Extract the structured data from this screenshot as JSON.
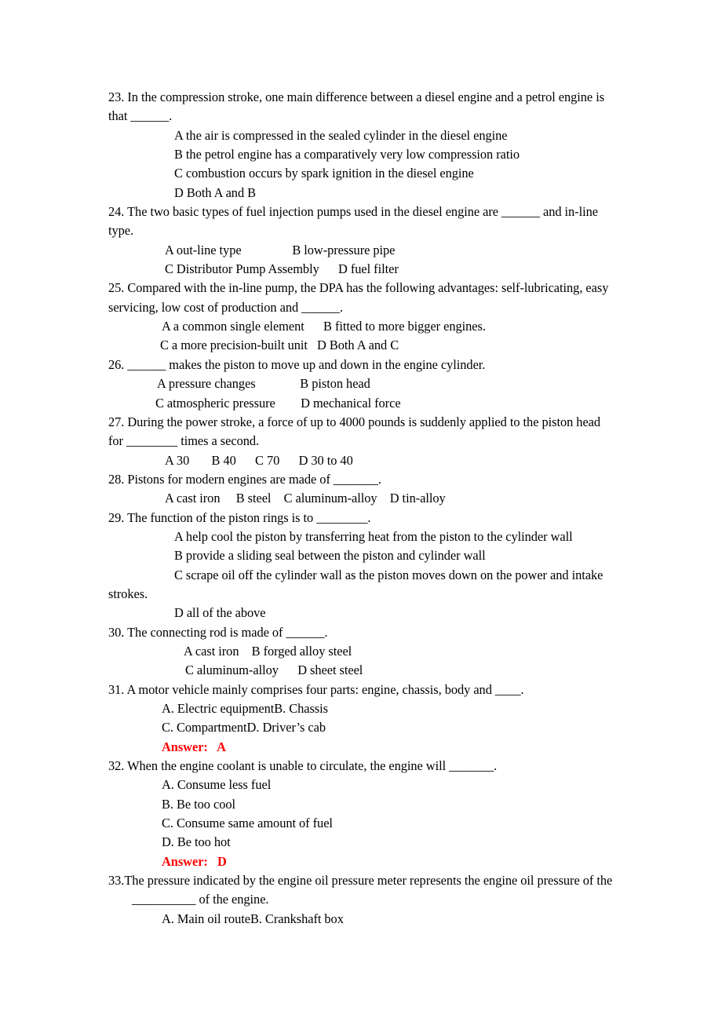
{
  "document": {
    "kind": "exam-question-paper",
    "answer_color": "#ff0000",
    "text_color": "#000000",
    "background_color": "#ffffff"
  },
  "questions": [
    {
      "number": "23",
      "stem_lines": [
        "23. In the compression stroke, one main difference between a diesel engine and a petrol engine is",
        "that ______."
      ],
      "option_lines": [
        "A the air is compressed in the sealed cylinder in the diesel engine",
        "B the petrol engine has a comparatively very low compression ratio",
        "C combustion occurs by spark ignition in the diesel engine",
        "D Both A and B"
      ],
      "answer": null
    },
    {
      "number": "24",
      "stem_lines": [
        "24. The two basic types of fuel injection pumps used in the diesel engine are ______ and in-line",
        "type."
      ],
      "option_lines": [
        "A out-line type                B low-pressure pipe",
        "C Distributor Pump Assembly      D fuel filter"
      ],
      "answer": null
    },
    {
      "number": "25",
      "stem_lines": [
        "25. Compared with the in-line pump, the DPA has the following advantages: self-lubricating, easy",
        "servicing, low cost of production and ______."
      ],
      "option_lines": [
        "A a common single element      B fitted to more bigger engines.",
        "C a more precision-built unit   D Both A and C"
      ],
      "answer": null
    },
    {
      "number": "26",
      "stem_lines": [
        "26. ______ makes the piston to move up and down in the engine cylinder."
      ],
      "option_lines": [
        "A pressure changes              B piston head",
        "C atmospheric pressure        D mechanical force"
      ],
      "answer": null
    },
    {
      "number": "27",
      "stem_lines": [
        "27. During the power stroke, a force of up to 4000 pounds is suddenly applied to the piston head",
        "for ________ times a second."
      ],
      "option_lines": [
        "A 30       B 40      C 70      D 30 to 40"
      ],
      "answer": null
    },
    {
      "number": "28",
      "stem_lines": [
        "28. Pistons for modern engines are made of _______."
      ],
      "option_lines": [
        "A cast iron     B steel    C aluminum-alloy    D tin-alloy"
      ],
      "answer": null
    },
    {
      "number": "29",
      "stem_lines": [
        "29. The function of the piston rings is to ________."
      ],
      "option_lines": [
        "A help cool the piston by transferring heat from the piston to the cylinder wall",
        "B provide a sliding seal between the piston and cylinder wall",
        "C scrape oil off the cylinder wall as the piston moves down on the power and intake",
        "strokes.",
        "D all of the above"
      ],
      "answer": null
    },
    {
      "number": "30",
      "stem_lines": [
        "30. The connecting rod is made of ______."
      ],
      "option_lines": [
        "A cast iron    B forged alloy steel",
        "C aluminum-alloy      D sheet steel"
      ],
      "answer": null
    },
    {
      "number": "31",
      "stem_lines": [
        "31. A motor vehicle mainly comprises four parts: engine, chassis, body and ____."
      ],
      "option_lines": [
        "A. Electric equipmentB. Chassis",
        "C. CompartmentD. Driver’s cab"
      ],
      "answer": "Answer:   A"
    },
    {
      "number": "32",
      "stem_lines": [
        "32. When the engine coolant is unable to circulate, the engine will _______."
      ],
      "option_lines": [
        "A. Consume less fuel",
        "B. Be too cool",
        "C. Consume same amount of fuel",
        "D. Be too hot"
      ],
      "answer": "Answer:   D"
    },
    {
      "number": "33",
      "stem_lines": [
        "33.The pressure indicated by the engine oil pressure meter represents the engine oil pressure of the",
        "__________ of the engine."
      ],
      "option_lines": [
        "A. Main oil routeB. Crankshaft box"
      ],
      "answer": null
    }
  ]
}
